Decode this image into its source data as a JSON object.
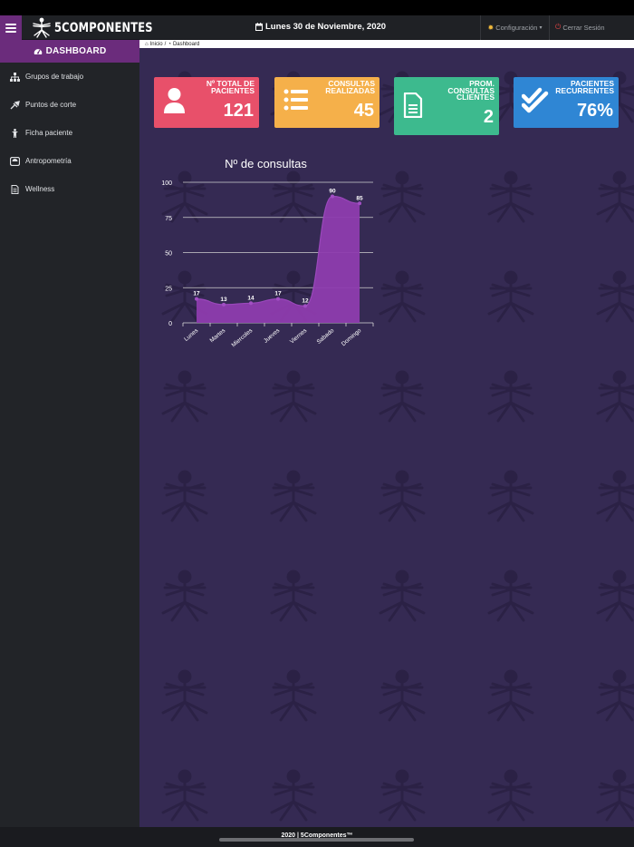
{
  "app": {
    "brand": "5COMPONENTES"
  },
  "header": {
    "date": "Lunes 30 de Noviembre, 2020",
    "config_label": "Configuración",
    "logout_label": "Cerrar Sesión"
  },
  "sidebar": {
    "title": "DASHBOARD",
    "items": [
      {
        "label": "Grupos de trabajo",
        "icon": "sitemap-icon"
      },
      {
        "label": "Puntos de corte",
        "icon": "needle-icon"
      },
      {
        "label": "Ficha paciente",
        "icon": "person-icon"
      },
      {
        "label": "Antropometría",
        "icon": "scale-icon"
      },
      {
        "label": "Wellness",
        "icon": "document-icon"
      }
    ]
  },
  "breadcrumb": {
    "home": "Inicio",
    "separator": "/",
    "current": "Dashboard"
  },
  "cards": [
    {
      "label": "Nº TOTAL DE PACIENTES",
      "value": "121",
      "color": "#e8506a",
      "icon": "user-icon"
    },
    {
      "label": "CONSULTAS REALIZADAS",
      "value": "45",
      "color": "#f5b04a",
      "icon": "list-icon"
    },
    {
      "label": "PROM. CONSULTAS CLIENTES",
      "value": "2",
      "color": "#3dba8e",
      "icon": "file-icon"
    },
    {
      "label": "PACIENTES RECURRENTES",
      "value": "76%",
      "color": "#2f86d4",
      "icon": "double-check-icon"
    }
  ],
  "chart_data": {
    "type": "area",
    "title": "Nº de consultas",
    "categories": [
      "Lunes",
      "Martes",
      "Miercoles",
      "Jueves",
      "Viernes",
      "Sabado",
      "Domingo"
    ],
    "series": [
      {
        "values": [
          17,
          13,
          14,
          17,
          12,
          90,
          85
        ],
        "color": "#8e3cae"
      }
    ],
    "ylim": [
      0,
      100
    ],
    "yticks": [
      0,
      25,
      50,
      75,
      100
    ],
    "grid": true,
    "data_labels": true
  },
  "footer": {
    "text": "2020 | 5Componentes™"
  }
}
